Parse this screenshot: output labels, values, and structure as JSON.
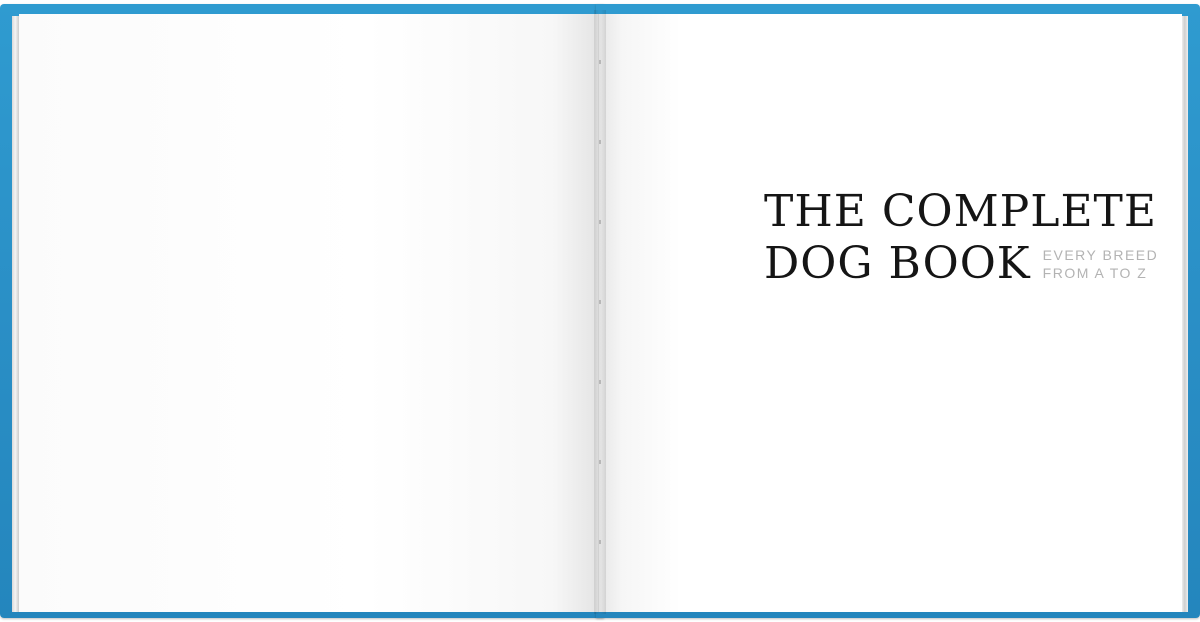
{
  "book": {
    "title_line_1": "THE COMPLETE",
    "title_line_2": "DOG BOOK",
    "subtitle_line_1": "EVERY BREED",
    "subtitle_line_2": "FROM A TO Z"
  },
  "colors": {
    "cover": "#2a8fc6",
    "title": "#151515",
    "subtitle": "#b3b3b3",
    "page": "#ffffff"
  }
}
